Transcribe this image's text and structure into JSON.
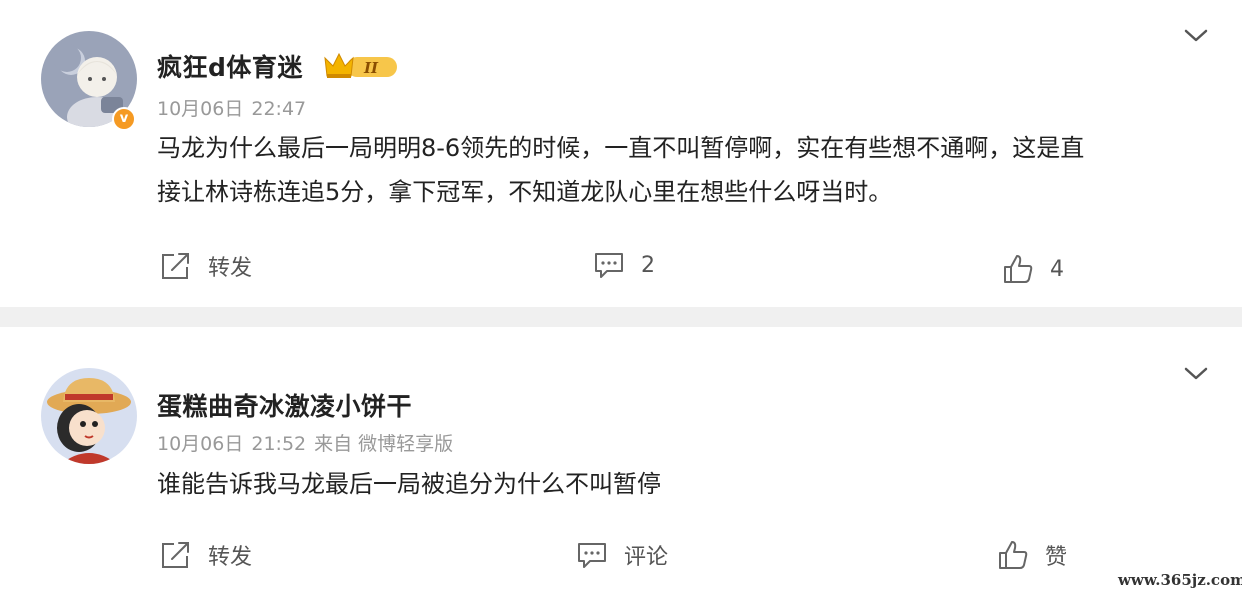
{
  "comments": [
    {
      "username": "疯狂d体育迷",
      "level_badge": "II",
      "verified_mark": "v",
      "date": "10月06日",
      "time": "22:47",
      "source": "",
      "text_lines": [
        "马龙为什么最后一局明明8-6领先的时候，一直不叫暂停啊，实在有些想不通啊，这是直",
        "接让林诗栋连追5分，拿下冠军，不知道龙队心里在想些什么呀当时。"
      ],
      "actions": {
        "repost": "转发",
        "comment": "2",
        "like": "4"
      },
      "icons": {
        "repost": "share-icon",
        "comment": "comment-icon",
        "like": "thumbs-up-icon",
        "more": "chevron-down-icon"
      }
    },
    {
      "username": "蛋糕曲奇冰激凌小饼干",
      "date": "10月06日",
      "time": "21:52",
      "source": "来自 微博轻享版",
      "text_lines": [
        "谁能告诉我马龙最后一局被追分为什么不叫暂停"
      ],
      "actions": {
        "repost": "转发",
        "comment": "评论",
        "like": "赞"
      },
      "icons": {
        "repost": "share-icon",
        "comment": "comment-icon",
        "like": "thumbs-up-icon",
        "more": "chevron-down-icon"
      }
    }
  ],
  "colors": {
    "background": "#f0f0f0",
    "card": "#ffffff",
    "crown": "#f4b400",
    "verified": "#f59a23"
  },
  "watermark": "www.365jz.com"
}
